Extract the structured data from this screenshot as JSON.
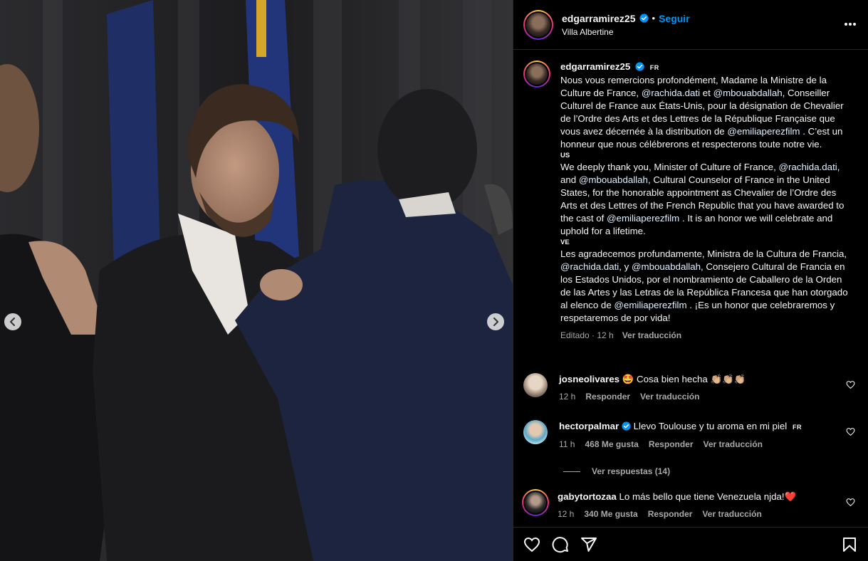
{
  "post": {
    "username": "edgarramirez25",
    "follow_label": "Seguir",
    "separator": "•",
    "location": "Villa Albertine"
  },
  "caption": {
    "username": "edgarramirez25",
    "lang_badge": "FR",
    "fr_text_1": "Nous vous remercions profondément, Madame la Ministre de la Culture de France,",
    "fr_mention_1": "@rachida.dati",
    "fr_text_2": "et",
    "fr_mention_2": "@mbouabdallah",
    "fr_text_3": ", Conseiller Culturel de France aux États-Unis, pour la désignation de Chevalier de l’Ordre des Arts et des Lettres de la République Française que vous avez décernée à la distribution de",
    "fr_mention_3": "@emiliaperezfilm",
    "fr_text_4": ". C’est un honneur que nous célébrerons et respecterons toute notre vie.",
    "us_tag": "US",
    "en_text_1": "We deeply thank you, Minister of Culture of France,",
    "en_mention_1": "@rachida.dati",
    "en_text_2": ", and",
    "en_mention_2": "@mbouabdallah",
    "en_text_3": ", Cultural Counselor of France in the United States, for the honorable appointment as Chevalier de l’Ordre des Arts et des Lettres of the French Republic that you have awarded to the cast of",
    "en_mention_3": "@emiliaperezfilm",
    "en_text_4": ". It is an honor we will celebrate and uphold for a lifetime.",
    "ve_tag": "VE",
    "es_text_1": "Les agradecemos profundamente, Ministra de la Cultura de Francia,",
    "es_mention_1": "@rachida.dati",
    "es_text_2": ", y",
    "es_mention_2": "@mbouabdallah",
    "es_text_3": ", Consejero Cultural de Francia en los Estados Unidos, por el nombramiento de Caballero de la Orden de las Artes y las Letras de la República Francesa que han otorgado al elenco de",
    "es_mention_3": "@emiliaperezfilm",
    "es_text_4": ". ¡Es un honor que celebraremos y respetaremos de por vida!",
    "edited": "Editado · 12 h",
    "translate": "Ver traducción"
  },
  "comments": [
    {
      "username": "josneolivares",
      "emoji": "🤩",
      "text": "Cosa bien hecha 👏🏼👏🏼👏🏼",
      "time": "12 h",
      "reply": "Responder",
      "translate": "Ver traducción",
      "avatar_color": "#c9b8a6"
    },
    {
      "username": "hectorpalmar",
      "text": "Llevo Toulouse y tu aroma en mi piel",
      "lang_badge": "FR",
      "time": "11 h",
      "likes": "468 Me gusta",
      "reply": "Responder",
      "translate": "Ver traducción",
      "view_replies": "Ver respuestas (14)",
      "avatar_color": "#7fc4d8"
    },
    {
      "username": "gabytortozaa",
      "text": "Lo más bello que tiene Venezuela njda!",
      "emoji": "❤️",
      "time": "12 h",
      "likes": "340 Me gusta",
      "reply": "Responder",
      "translate": "Ver traducción",
      "avatar_color": "#3a3a3a"
    }
  ],
  "icons": {
    "verified": "verified-icon",
    "heart": "heart-icon",
    "comment": "comment-icon",
    "share": "share-icon",
    "bookmark": "bookmark-icon",
    "prev": "chevron-left-icon",
    "next": "chevron-right-icon",
    "more": "more-icon"
  },
  "colors": {
    "accent": "#0095f6",
    "background": "#000000",
    "muted": "#a8a8a8",
    "like": "#ed4956"
  }
}
